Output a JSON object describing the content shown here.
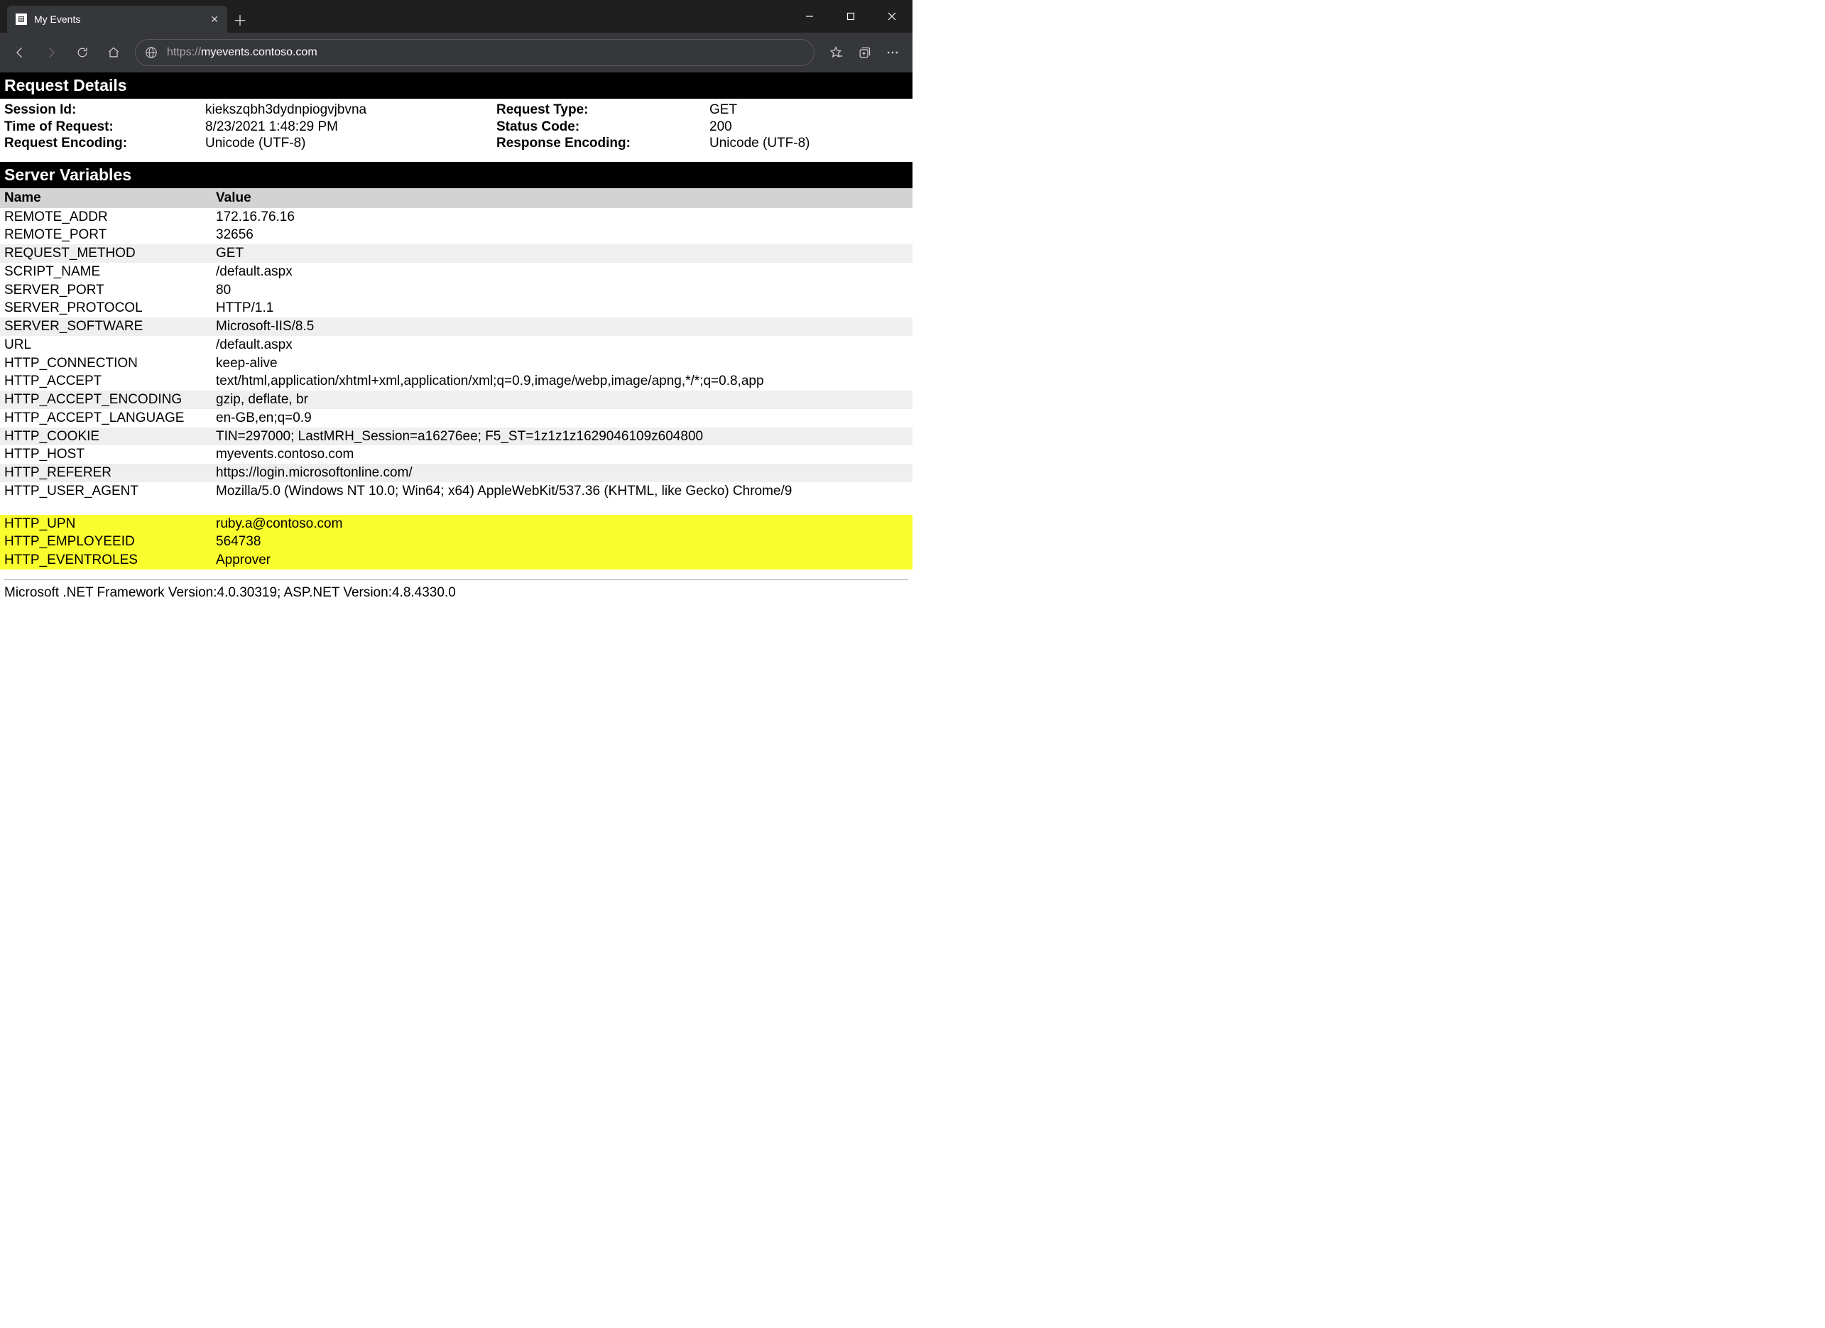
{
  "browser": {
    "tab_title": "My Events",
    "url_protocol": "https://",
    "url_host": "myevents.contoso.com"
  },
  "sections": {
    "request_details": "Request Details",
    "server_variables": "Server Variables"
  },
  "details": {
    "session_id_label": "Session Id:",
    "session_id": "kiekszqbh3dydnpiogvjbvna",
    "request_type_label": "Request Type:",
    "request_type": "GET",
    "time_label": "Time of Request:",
    "time": "8/23/2021 1:48:29 PM",
    "status_label": "Status Code:",
    "status": "200",
    "req_enc_label": "Request Encoding:",
    "req_enc": "Unicode (UTF-8)",
    "resp_enc_label": "Response Encoding:",
    "resp_enc": "Unicode (UTF-8)"
  },
  "vars_header": {
    "name": "Name",
    "value": "Value"
  },
  "vars": [
    {
      "name": "REMOTE_ADDR",
      "value": "172.16.76.16",
      "alt": false
    },
    {
      "name": "REMOTE_PORT",
      "value": "32656",
      "alt": false
    },
    {
      "name": "REQUEST_METHOD",
      "value": "GET",
      "alt": true
    },
    {
      "name": "SCRIPT_NAME",
      "value": "/default.aspx",
      "alt": false
    },
    {
      "name": "SERVER_PORT",
      "value": "80",
      "alt": false
    },
    {
      "name": "SERVER_PROTOCOL",
      "value": "HTTP/1.1",
      "alt": false
    },
    {
      "name": "SERVER_SOFTWARE",
      "value": "Microsoft-IIS/8.5",
      "alt": true
    },
    {
      "name": "URL",
      "value": "/default.aspx",
      "alt": false
    },
    {
      "name": "HTTP_CONNECTION",
      "value": "keep-alive",
      "alt": false
    },
    {
      "name": "HTTP_ACCEPT",
      "value": "text/html,application/xhtml+xml,application/xml;q=0.9,image/webp,image/apng,*/*;q=0.8,app",
      "alt": false
    },
    {
      "name": "HTTP_ACCEPT_ENCODING",
      "value": "gzip, deflate, br",
      "alt": true
    },
    {
      "name": "HTTP_ACCEPT_LANGUAGE",
      "value": "en-GB,en;q=0.9",
      "alt": false
    },
    {
      "name": "HTTP_COOKIE",
      "value": "TIN=297000; LastMRH_Session=a16276ee; F5_ST=1z1z1z1629046109z604800",
      "alt": true
    },
    {
      "name": "HTTP_HOST",
      "value": "myevents.contoso.com",
      "alt": false
    },
    {
      "name": "HTTP_REFERER",
      "value": "https://login.microsoftonline.com/",
      "alt": true
    },
    {
      "name": "HTTP_USER_AGENT",
      "value": "Mozilla/5.0 (Windows NT 10.0; Win64; x64) AppleWebKit/537.36 (KHTML, like Gecko) Chrome/9",
      "alt": false
    }
  ],
  "highlighted_vars": [
    {
      "name": "HTTP_UPN",
      "value": "ruby.a@contoso.com"
    },
    {
      "name": "HTTP_EMPLOYEEID",
      "value": "564738"
    },
    {
      "name": "HTTP_EVENTROLES",
      "value": "Approver"
    }
  ],
  "footer": "Microsoft .NET Framework Version:4.0.30319; ASP.NET Version:4.8.4330.0"
}
